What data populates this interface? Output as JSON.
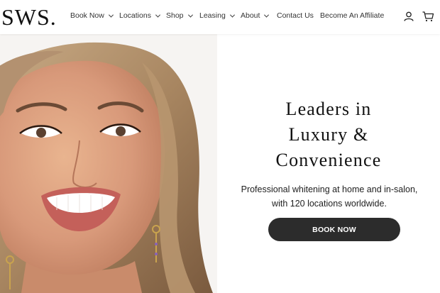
{
  "brand": {
    "logo_text": "SWS."
  },
  "nav": {
    "items": [
      {
        "label": "Book Now",
        "has_dropdown": true
      },
      {
        "label": "Locations",
        "has_dropdown": true
      },
      {
        "label": "Shop",
        "has_dropdown": true
      },
      {
        "label": "Leasing",
        "has_dropdown": true
      },
      {
        "label": "About",
        "has_dropdown": true
      },
      {
        "label": "Contact Us",
        "has_dropdown": false
      },
      {
        "label": "Become An Affiliate",
        "has_dropdown": false
      }
    ],
    "account_icon": "user-icon",
    "cart_icon": "cart-icon"
  },
  "hero": {
    "headline_lines": [
      "Leaders in",
      "Luxury &",
      "Convenience"
    ],
    "subtext_lines": [
      "Professional whitening at home and in-salon,",
      "with 120 locations worldwide."
    ],
    "cta_label": "BOOK NOW",
    "image_description_icon": "smiling-woman-photo"
  },
  "colors": {
    "button_bg": "#2c2c2c",
    "text": "#111111",
    "background": "#ffffff"
  }
}
